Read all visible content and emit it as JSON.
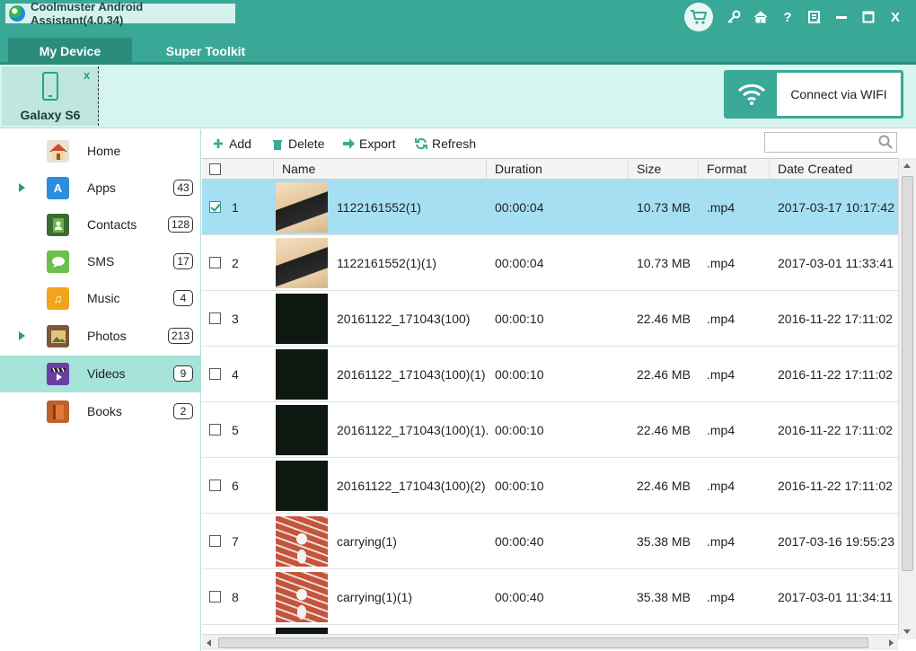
{
  "app": {
    "title": "Coolmuster Android Assistant(4.0.34)",
    "title_icons": [
      "cart-icon",
      "key-icon",
      "home-icon",
      "help-icon",
      "feedback-icon",
      "minimize-icon",
      "maximize-icon",
      "close-icon"
    ],
    "help_glyph": "?",
    "close_glyph": "X"
  },
  "tabs": [
    {
      "label": "My Device",
      "active": true
    },
    {
      "label": "Super Toolkit",
      "active": false
    }
  ],
  "device": {
    "name": "Galaxy S6",
    "close_glyph": "x"
  },
  "wifi": {
    "label": "Connect via WIFI"
  },
  "sidebar": {
    "items": [
      {
        "label": "Home",
        "count": null,
        "icon": "home-icon",
        "expandable": false,
        "active": false
      },
      {
        "label": "Apps",
        "count": "43",
        "icon": "apps-icon",
        "expandable": true,
        "active": false
      },
      {
        "label": "Contacts",
        "count": "128",
        "icon": "contacts-icon",
        "expandable": false,
        "active": false
      },
      {
        "label": "SMS",
        "count": "17",
        "icon": "sms-icon",
        "expandable": false,
        "active": false
      },
      {
        "label": "Music",
        "count": "4",
        "icon": "music-icon",
        "expandable": false,
        "active": false
      },
      {
        "label": "Photos",
        "count": "213",
        "icon": "photos-icon",
        "expandable": true,
        "active": false
      },
      {
        "label": "Videos",
        "count": "9",
        "icon": "videos-icon",
        "expandable": false,
        "active": true
      },
      {
        "label": "Books",
        "count": "2",
        "icon": "books-icon",
        "expandable": false,
        "active": false
      }
    ]
  },
  "toolbar": {
    "add": "Add",
    "delete": "Delete",
    "export": "Export",
    "refresh": "Refresh",
    "search_value": ""
  },
  "table": {
    "columns": {
      "name": "Name",
      "duration": "Duration",
      "size": "Size",
      "format": "Format",
      "date": "Date Created"
    },
    "rows": [
      {
        "num": "1",
        "name": "1122161552(1)",
        "duration": "00:00:04",
        "size": "10.73 MB",
        "format": ".mp4",
        "date": "2017-03-17 10:17:42",
        "checked": true,
        "selected": true,
        "thumb": "phone"
      },
      {
        "num": "2",
        "name": "1122161552(1)(1)",
        "duration": "00:00:04",
        "size": "10.73 MB",
        "format": ".mp4",
        "date": "2017-03-01 11:33:41",
        "checked": false,
        "selected": false,
        "thumb": "phone"
      },
      {
        "num": "3",
        "name": "20161122_171043(100)",
        "duration": "00:00:10",
        "size": "22.46 MB",
        "format": ".mp4",
        "date": "2016-11-22 17:11:02",
        "checked": false,
        "selected": false,
        "thumb": "dark"
      },
      {
        "num": "4",
        "name": "20161122_171043(100)(1)",
        "duration": "00:00:10",
        "size": "22.46 MB",
        "format": ".mp4",
        "date": "2016-11-22 17:11:02",
        "checked": false,
        "selected": false,
        "thumb": "dark"
      },
      {
        "num": "5",
        "name": "20161122_171043(100)(1)...",
        "duration": "00:00:10",
        "size": "22.46 MB",
        "format": ".mp4",
        "date": "2016-11-22 17:11:02",
        "checked": false,
        "selected": false,
        "thumb": "dark"
      },
      {
        "num": "6",
        "name": "20161122_171043(100)(2)",
        "duration": "00:00:10",
        "size": "22.46 MB",
        "format": ".mp4",
        "date": "2016-11-22 17:11:02",
        "checked": false,
        "selected": false,
        "thumb": "dark"
      },
      {
        "num": "7",
        "name": "carrying(1)",
        "duration": "00:00:40",
        "size": "35.38 MB",
        "format": ".mp4",
        "date": "2017-03-16 19:55:23",
        "checked": false,
        "selected": false,
        "thumb": "run"
      },
      {
        "num": "8",
        "name": "carrying(1)(1)",
        "duration": "00:00:40",
        "size": "35.38 MB",
        "format": ".mp4",
        "date": "2017-03-01 11:34:11",
        "checked": false,
        "selected": false,
        "thumb": "run"
      }
    ]
  },
  "colors": {
    "brand": "#3aa896",
    "brand_dark": "#2c8c7c",
    "selected_row": "#a6def2",
    "active_sidebar": "#a6e3d8"
  }
}
